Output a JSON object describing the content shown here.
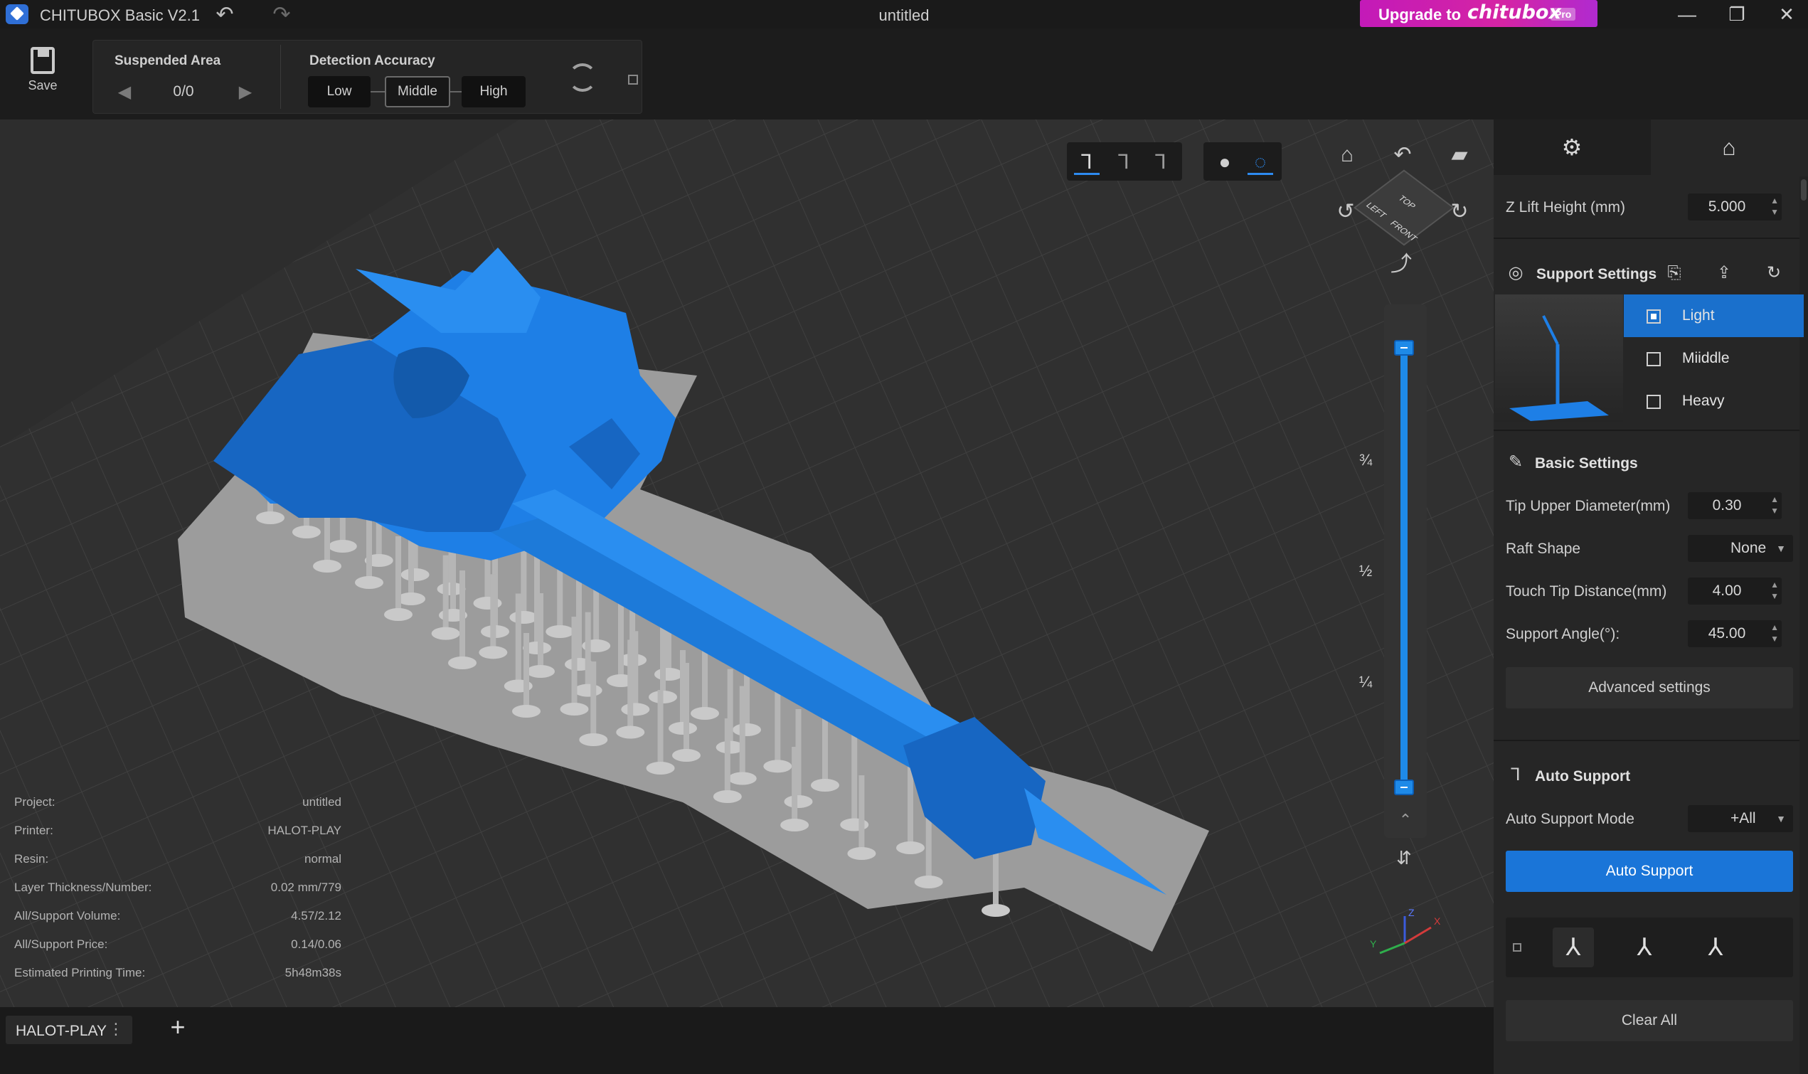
{
  "app": {
    "title": "CHITUBOX Basic V2.1",
    "document_title": "untitled"
  },
  "upgrade": {
    "prefix": "Upgrade to",
    "brand": "chitubox",
    "badge": "Pro"
  },
  "toolbar": {
    "save_label": "Save",
    "suspended_area": {
      "heading": "Suspended Area",
      "count": "0/0"
    },
    "detection_accuracy": {
      "heading": "Detection Accuracy",
      "options": [
        "Low",
        "Middle",
        "High"
      ],
      "selected": "Middle"
    }
  },
  "viewport": {
    "layer_fractions": [
      "¾",
      "½",
      "¼"
    ],
    "cube_faces": {
      "top": "TOP",
      "left": "LEFT",
      "front": "FRONT"
    },
    "axes": {
      "x": "X",
      "y": "Y",
      "z": "Z"
    },
    "info": [
      {
        "key": "Project:",
        "value": "untitled"
      },
      {
        "key": "Printer:",
        "value": "HALOT-PLAY"
      },
      {
        "key": "Resin:",
        "value": "normal"
      },
      {
        "key": "Layer Thickness/Number:",
        "value": "0.02 mm/779"
      },
      {
        "key": "All/Support Volume:",
        "value": "4.57/2.12"
      },
      {
        "key": "All/Support Price:",
        "value": "0.14/0.06"
      },
      {
        "key": "Estimated Printing Time:",
        "value": "5h48m38s"
      }
    ]
  },
  "tabs": {
    "printer": "HALOT-PLAY",
    "add": "+"
  },
  "right_panel": {
    "z_lift": {
      "label": "Z Lift Height (mm)",
      "value": "5.000"
    },
    "support_settings": {
      "heading": "Support Settings",
      "density_options": [
        "Light",
        "Miiddle",
        "Heavy"
      ],
      "selected": "Light"
    },
    "basic_settings": {
      "heading": "Basic Settings",
      "fields": [
        {
          "label": "Tip Upper Diameter(mm)",
          "value": "0.30"
        },
        {
          "label": "Raft Shape",
          "value": "None"
        },
        {
          "label": "Touch Tip Distance(mm)",
          "value": "4.00"
        },
        {
          "label": "Support Angle(°):",
          "value": "45.00"
        }
      ],
      "advanced_label": "Advanced settings"
    },
    "auto_support": {
      "heading": "Auto Support",
      "mode_label": "Auto Support Mode",
      "mode_value": "+All",
      "button_label": "Auto Support"
    },
    "clear_all_label": "Clear All"
  },
  "colors": {
    "accent": "#1a75d8",
    "model": "#1e7fe6",
    "support": "#a9a9a9",
    "plate": "#9c9c9c"
  }
}
